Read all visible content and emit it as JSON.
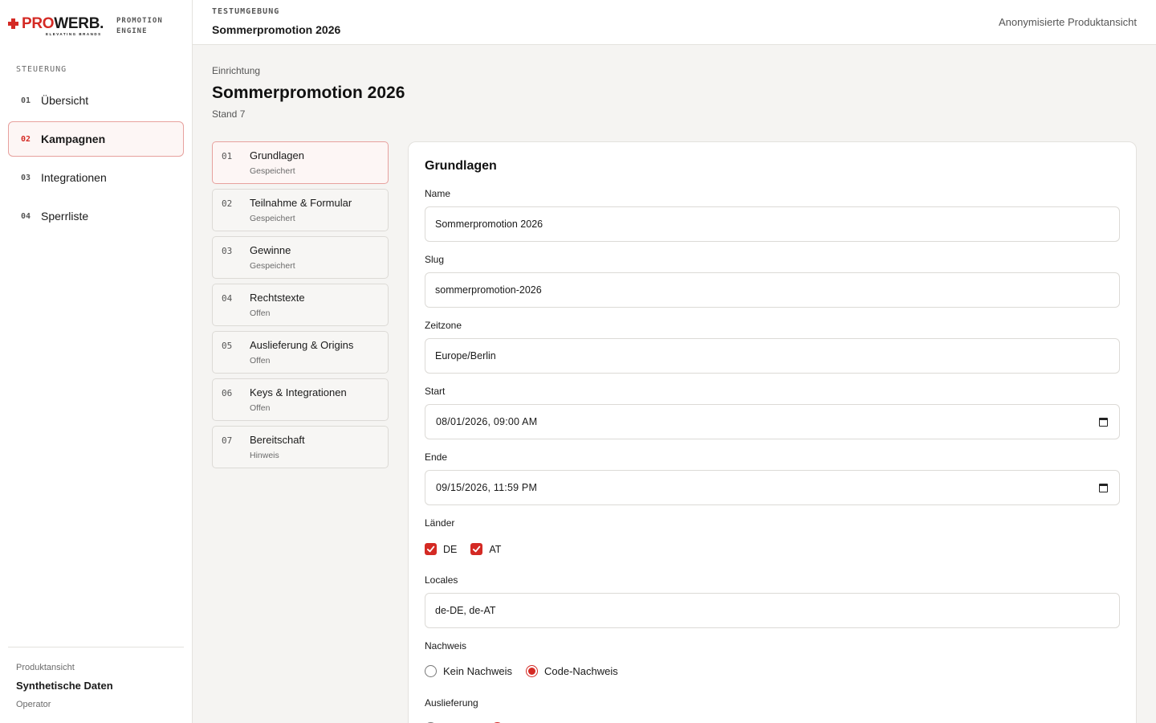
{
  "brand": {
    "name_red": "PRO",
    "name_dark": "WERB.",
    "tagline": "ELEVATING BRANDS",
    "product_line1": "PROMOTION",
    "product_line2": "ENGINE"
  },
  "sidebar": {
    "section": "STEUERUNG",
    "items": [
      {
        "num": "01",
        "label": "Übersicht"
      },
      {
        "num": "02",
        "label": "Kampagnen"
      },
      {
        "num": "03",
        "label": "Integrationen"
      },
      {
        "num": "04",
        "label": "Sperrliste"
      }
    ],
    "footer": {
      "label": "Produktansicht",
      "name": "Synthetische Daten",
      "role": "Operator"
    }
  },
  "topbar": {
    "environment": "TESTUMGEBUNG",
    "title": "Sommerpromotion 2026",
    "right": "Anonymisierte Produktansicht"
  },
  "page": {
    "breadcrumb": "Einrichtung",
    "title": "Sommerpromotion 2026",
    "subtitle": "Stand 7"
  },
  "steps": [
    {
      "num": "01",
      "title": "Grundlagen",
      "status": "Gespeichert"
    },
    {
      "num": "02",
      "title": "Teilnahme & Formular",
      "status": "Gespeichert"
    },
    {
      "num": "03",
      "title": "Gewinne",
      "status": "Gespeichert"
    },
    {
      "num": "04",
      "title": "Rechtstexte",
      "status": "Offen"
    },
    {
      "num": "05",
      "title": "Auslieferung & Origins",
      "status": "Offen"
    },
    {
      "num": "06",
      "title": "Keys & Integrationen",
      "status": "Offen"
    },
    {
      "num": "07",
      "title": "Bereitschaft",
      "status": "Hinweis"
    }
  ],
  "form": {
    "title": "Grundlagen",
    "name": {
      "label": "Name",
      "value": "Sommerpromotion 2026"
    },
    "slug": {
      "label": "Slug",
      "value": "sommerpromotion-2026"
    },
    "timezone": {
      "label": "Zeitzone",
      "value": "Europe/Berlin"
    },
    "start": {
      "label": "Start",
      "value": "08/01/2026, 09:00 AM"
    },
    "end": {
      "label": "Ende",
      "value": "09/15/2026, 11:59 PM"
    },
    "countries": {
      "label": "Länder",
      "options": [
        "DE",
        "AT"
      ]
    },
    "locales": {
      "label": "Locales",
      "value": "de-DE, de-AT"
    },
    "proof": {
      "label": "Nachweis",
      "options": [
        "Kein Nachweis",
        "Code-Nachweis"
      ],
      "selected": "Code-Nachweis"
    },
    "delivery": {
      "label": "Auslieferung"
    }
  },
  "colors": {
    "accent": "#d42a24",
    "active_bg": "#fdf6f5",
    "active_border": "#e7a19e"
  }
}
